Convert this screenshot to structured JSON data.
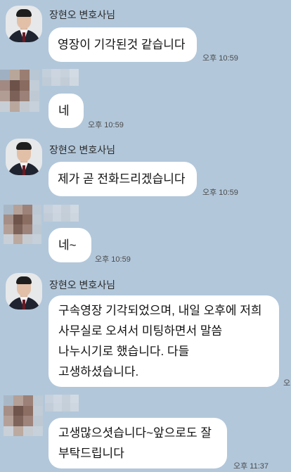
{
  "sender_name": "장현오 변호사님",
  "messages": [
    {
      "from": "lawyer",
      "lines": [
        "영장이 기각된것 같습니다"
      ],
      "time": "오후 10:59"
    },
    {
      "from": "user",
      "lines": [
        "네"
      ],
      "time": "오후 10:59"
    },
    {
      "from": "lawyer",
      "lines": [
        "제가 곧 전화드리겠습니다"
      ],
      "time": "오후 10:59"
    },
    {
      "from": "user",
      "lines": [
        "네~"
      ],
      "time": "오후 10:59"
    },
    {
      "from": "lawyer",
      "lines": [
        "구속영장 기각되었으며, 내일 오후에 저희",
        "사무실로 오셔서 미팅하면서 말씀",
        "나누시기로 했습니다. 다들",
        "고생하셨습니다."
      ],
      "time": "오"
    },
    {
      "from": "user",
      "lines": [
        "고생많으셧습니다~앞으로도 잘",
        "부탁드립니다"
      ],
      "time": "오후 11:37"
    }
  ],
  "colors": {
    "background": "#b2c7da",
    "bubble": "#ffffff"
  }
}
